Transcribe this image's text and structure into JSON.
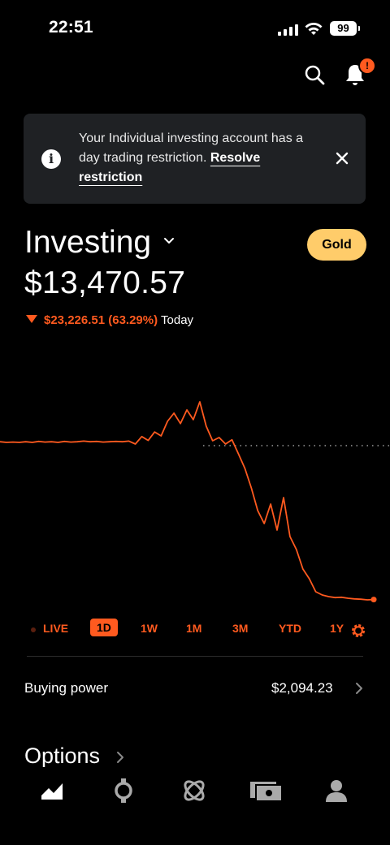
{
  "status_bar": {
    "time": "22:51",
    "battery": "99"
  },
  "header": {
    "notification_badge": "!"
  },
  "banner": {
    "text": "Your Individual investing account has a day trading restriction.",
    "link": "Resolve restriction"
  },
  "account": {
    "title": "Investing",
    "tier_button": "Gold",
    "balance": "$13,470.57",
    "change_value": "$23,226.51 (63.29%)",
    "change_period": "Today"
  },
  "time_ranges": [
    "LIVE",
    "1D",
    "1W",
    "1M",
    "3M",
    "YTD",
    "1Y"
  ],
  "selected_range": "1D",
  "buying_power": {
    "label": "Buying power",
    "value": "$2,094.23"
  },
  "options_section": {
    "label": "Options"
  },
  "colors": {
    "accent": "#ff5a1f",
    "gold": "#ffcc6a",
    "banner_bg": "#1f2124"
  },
  "nav_icons": [
    "investing-chart-icon",
    "crypto-icon",
    "network-icon",
    "cash-icon",
    "account-person-icon"
  ],
  "chart_data": {
    "type": "line",
    "series": [
      {
        "values": [
          1.2,
          1.0,
          1.1,
          1.0,
          1.2,
          1.0,
          1.3,
          1.1,
          1.2,
          1.0,
          1.3,
          1.1,
          1.2,
          1.4,
          1.2,
          1.3,
          1.1,
          1.2,
          1.3,
          1.2,
          1.4,
          0.5,
          2.8,
          1.6,
          4.2,
          3.0,
          7.5,
          10.0,
          6.8,
          11.0,
          8.0,
          13.5,
          6.0,
          1.5,
          2.5,
          0.5,
          1.8,
          -2.5,
          -7.0,
          -13.0,
          -20.0,
          -24.0,
          -18.0,
          -26.0,
          -16.0,
          -28.0,
          -32.0,
          -38.0,
          -41.0,
          -45.0,
          -46.0,
          -46.5,
          -46.8,
          -46.7,
          -47.0,
          -47.2,
          -47.3,
          -47.5,
          -47.4
        ]
      }
    ],
    "reference_line": "dotted"
  }
}
